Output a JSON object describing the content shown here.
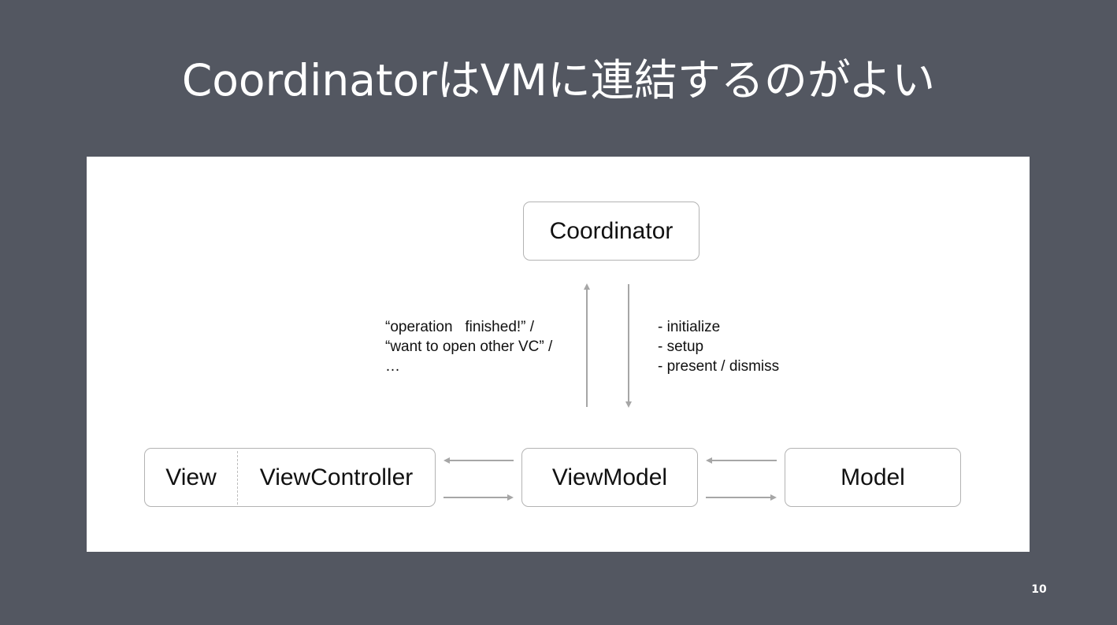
{
  "slide": {
    "title": "CoordinatorはVMに連結するのがよい",
    "page_number": "10"
  },
  "diagram": {
    "nodes": {
      "coordinator": "Coordinator",
      "view": "View",
      "view_controller": "ViewController",
      "view_model": "ViewModel",
      "model": "Model"
    },
    "notes": {
      "to_coordinator": [
        "“operation   finished!” /",
        "“want to open other VC” /",
        "…"
      ],
      "from_coordinator": [
        "- initialize",
        "- setup",
        "- present / dismiss"
      ]
    }
  },
  "colors": {
    "background": "#535761",
    "panel": "#ffffff",
    "box_border": "#b3b3b3",
    "arrow": "#a6a6a6",
    "text_on_dark": "#ffffff",
    "text_on_light": "#111111"
  }
}
